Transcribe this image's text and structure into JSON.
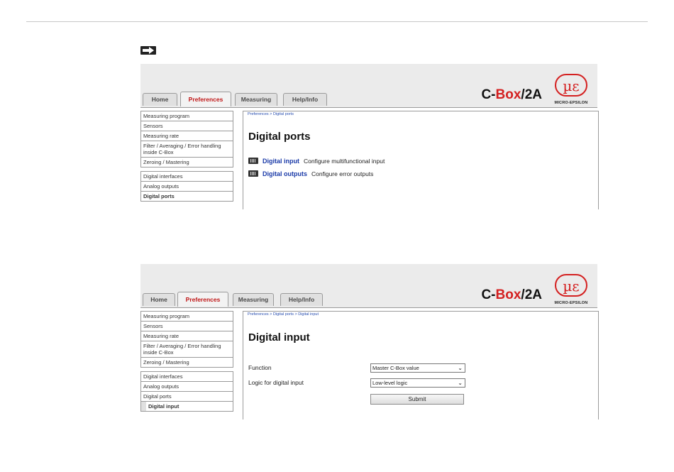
{
  "tabs": [
    "Home",
    "Preferences",
    "Measuring",
    "Help/Info"
  ],
  "brand": {
    "prefix": "C-",
    "highlight": "Box",
    "suffix": "/2A"
  },
  "logo": {
    "mark": "µε",
    "caption": "MICRO-EPSILON"
  },
  "colors": {
    "accent": "#d42020",
    "link": "#1a3aa8",
    "bar": "#ebebeb"
  },
  "sidebar": {
    "measuring_program": "Measuring program",
    "sensors": "Sensors",
    "measuring_rate": "Measuring rate",
    "filter": "Filter / Averaging / Error handling inside C-Box",
    "zeroing": "Zeroing / Mastering",
    "digital_interfaces": "Digital interfaces",
    "analog_outputs": "Analog outputs",
    "digital_ports": "Digital ports",
    "digital_input": "Digital input"
  },
  "panel1": {
    "breadcrumb": "Preferences > Digital ports",
    "heading": "Digital ports",
    "links": [
      {
        "label": "Digital input",
        "desc": "Configure multifunctional input"
      },
      {
        "label": "Digital outputs",
        "desc": "Configure error outputs"
      }
    ]
  },
  "panel2": {
    "breadcrumb": "Preferences > Digital ports > Digital input",
    "heading": "Digital input",
    "function_label": "Function",
    "function_value": "Master C-Box value",
    "logic_label": "Logic for digital input",
    "logic_value": "Low-level logic",
    "submit": "Submit"
  }
}
